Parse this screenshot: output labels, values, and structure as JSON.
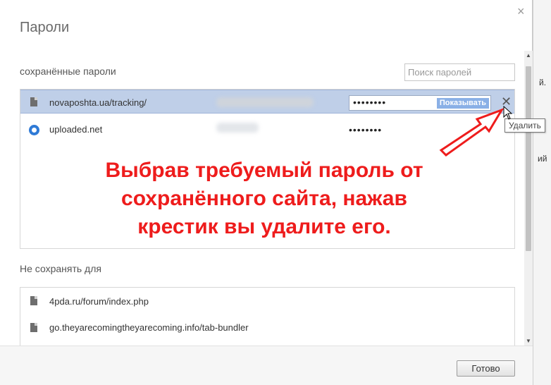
{
  "dialog": {
    "title": "Пароли",
    "close_glyph": "×",
    "saved_section_label": "сохранённые пароли",
    "search_placeholder": "Поиск паролей",
    "saved_rows": [
      {
        "site": "novaposhta.ua/tracking/",
        "password_masked": "••••••••",
        "show_label": "Показывать",
        "icon": "file-icon"
      },
      {
        "site": "uploaded.net",
        "password_masked": "••••••••",
        "icon": "uploaded-site-icon"
      }
    ],
    "delete_glyph": "✕",
    "delete_tooltip": "Удалить",
    "never_section_label": "Не сохранять для",
    "never_rows": [
      {
        "site": "4pda.ru/forum/index.php",
        "icon": "file-icon"
      },
      {
        "site": "go.theyarecomingtheyarecoming.info/tab-bundler",
        "icon": "file-icon"
      }
    ],
    "done_label": "Готово"
  },
  "annotation": {
    "lines": [
      "Выбрав требуемый пароль от",
      "сохранённого сайта, нажав",
      "крестик вы удалите его."
    ],
    "color": "#ee1c1c"
  },
  "background_page": {
    "snippet_1": "й.",
    "snippet_2": "ий",
    "snippet_3": "ий"
  },
  "colors": {
    "selected_row": "#bfcfe8",
    "show_button": "#8ab0e6",
    "annotation_arrow": "#ee1c1c"
  }
}
